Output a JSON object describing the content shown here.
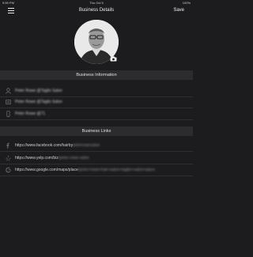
{
  "status_bar": {
    "time": "9:59 PM",
    "date": "Thu Oct 5",
    "battery": "100%"
  },
  "navbar": {
    "title": "Business Details",
    "save_label": "Save"
  },
  "business_information": {
    "header": "Business Information",
    "rows": [
      {
        "icon": "person-icon",
        "text": "Peter Rowe @Taglio Salon"
      },
      {
        "icon": "address-icon",
        "text": "Peter Rowe @Taglio Salon"
      },
      {
        "icon": "phone-icon",
        "text": "Peter Rowe @71"
      }
    ]
  },
  "business_links": {
    "header": "Business Links",
    "rows": [
      {
        "icon": "facebook-icon",
        "text": "https://www.facebook.com/hairby",
        "hidden_suffix": "peterrowesalon"
      },
      {
        "icon": "yelp-icon",
        "text": "https://www.yelp.com/biz",
        "hidden_suffix": "/peter-rowe-salon"
      },
      {
        "icon": "google-icon",
        "text": "https://www.google.com/maps/place",
        "hidden_suffix": "/peter+rowe+hair+salon+taglio+salon+place"
      }
    ]
  },
  "colors": {
    "background": "#1c1c1e",
    "section_header": "#2c2c2e",
    "text": "#d8d8d8"
  }
}
